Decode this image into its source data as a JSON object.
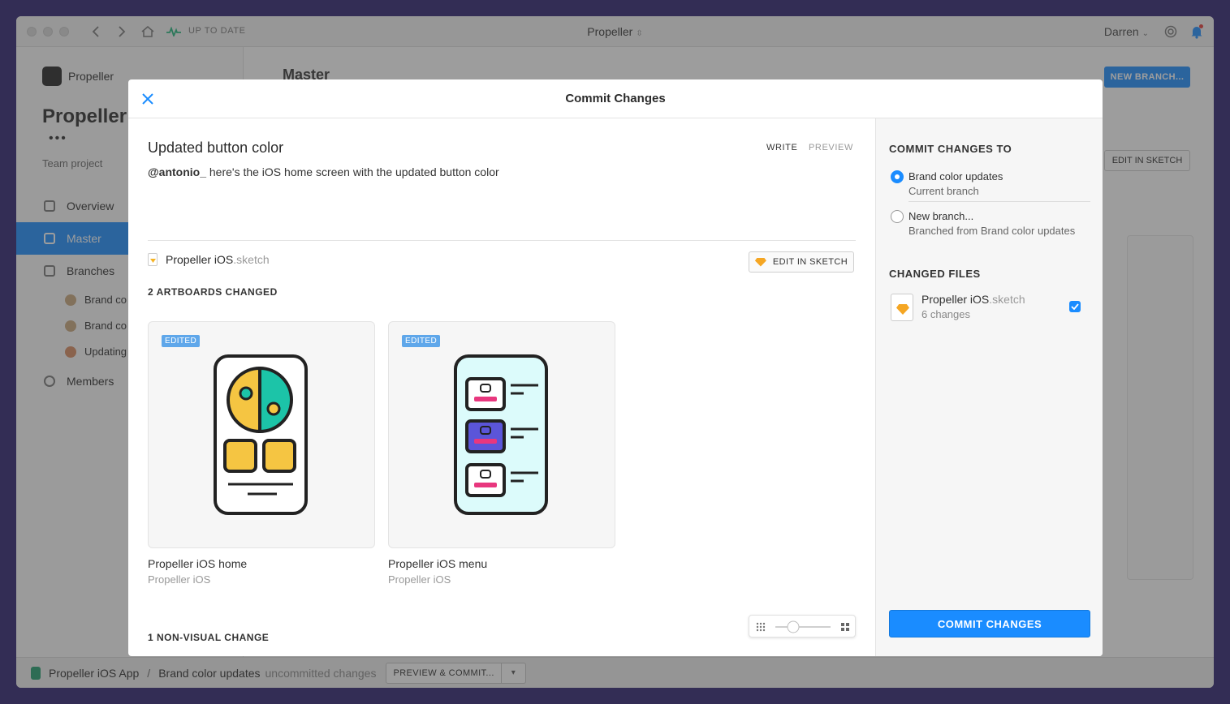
{
  "titlebar": {
    "status": "UP TO DATE",
    "title": "Propeller",
    "user": "Darren"
  },
  "sidebar": {
    "project_name": "Propeller",
    "title": "Propeller",
    "team": "Team project",
    "nav": [
      {
        "label": "Overview"
      },
      {
        "label": "Master"
      },
      {
        "label": "Branches"
      },
      {
        "label": "Members"
      }
    ],
    "branches": [
      {
        "label": "Brand co"
      },
      {
        "label": "Brand co"
      },
      {
        "label": "Updating"
      }
    ]
  },
  "background": {
    "heading": "Master",
    "new_branch": "NEW BRANCH...",
    "edit_in_sketch": "EDIT IN SKETCH"
  },
  "statusbar": {
    "app": "Propeller iOS App",
    "separator": "/",
    "branch": "Brand color updates",
    "state": "uncommitted changes",
    "preview_commit": "PREVIEW & COMMIT..."
  },
  "modal": {
    "title": "Commit Changes",
    "commit_title": "Updated button color",
    "tabs": {
      "write": "WRITE",
      "preview": "PREVIEW"
    },
    "message": {
      "mention": "@antonio_",
      "text": " here's the iOS home screen with the updated button color"
    },
    "file": {
      "name": "Propeller iOS",
      "ext": ".sketch"
    },
    "edit_in_sketch": "EDIT IN SKETCH",
    "artboards_changed": "2 ARTBOARDS CHANGED",
    "artboards": [
      {
        "badge": "EDITED",
        "name": "Propeller iOS home",
        "document": "Propeller iOS"
      },
      {
        "badge": "EDITED",
        "name": "Propeller iOS menu",
        "document": "Propeller iOS"
      }
    ],
    "nonvisual": "1 NON-VISUAL CHANGE"
  },
  "commit_panel": {
    "target_heading": "COMMIT CHANGES TO",
    "options": [
      {
        "label": "Brand color updates",
        "sub": "Current branch",
        "selected": true
      },
      {
        "label": "New branch...",
        "sub": "Branched from Brand color updates",
        "selected": false
      }
    ],
    "files_heading": "CHANGED FILES",
    "changed_file": {
      "name": "Propeller iOS",
      "ext": ".sketch",
      "changes": "6 changes",
      "checked": true
    },
    "commit_button": "COMMIT CHANGES"
  },
  "colors": {
    "accent": "#1a8cff",
    "edited_badge": "#5fa7ea",
    "sketch_diamond": "#f5a623",
    "background": "#2a1f6e"
  }
}
